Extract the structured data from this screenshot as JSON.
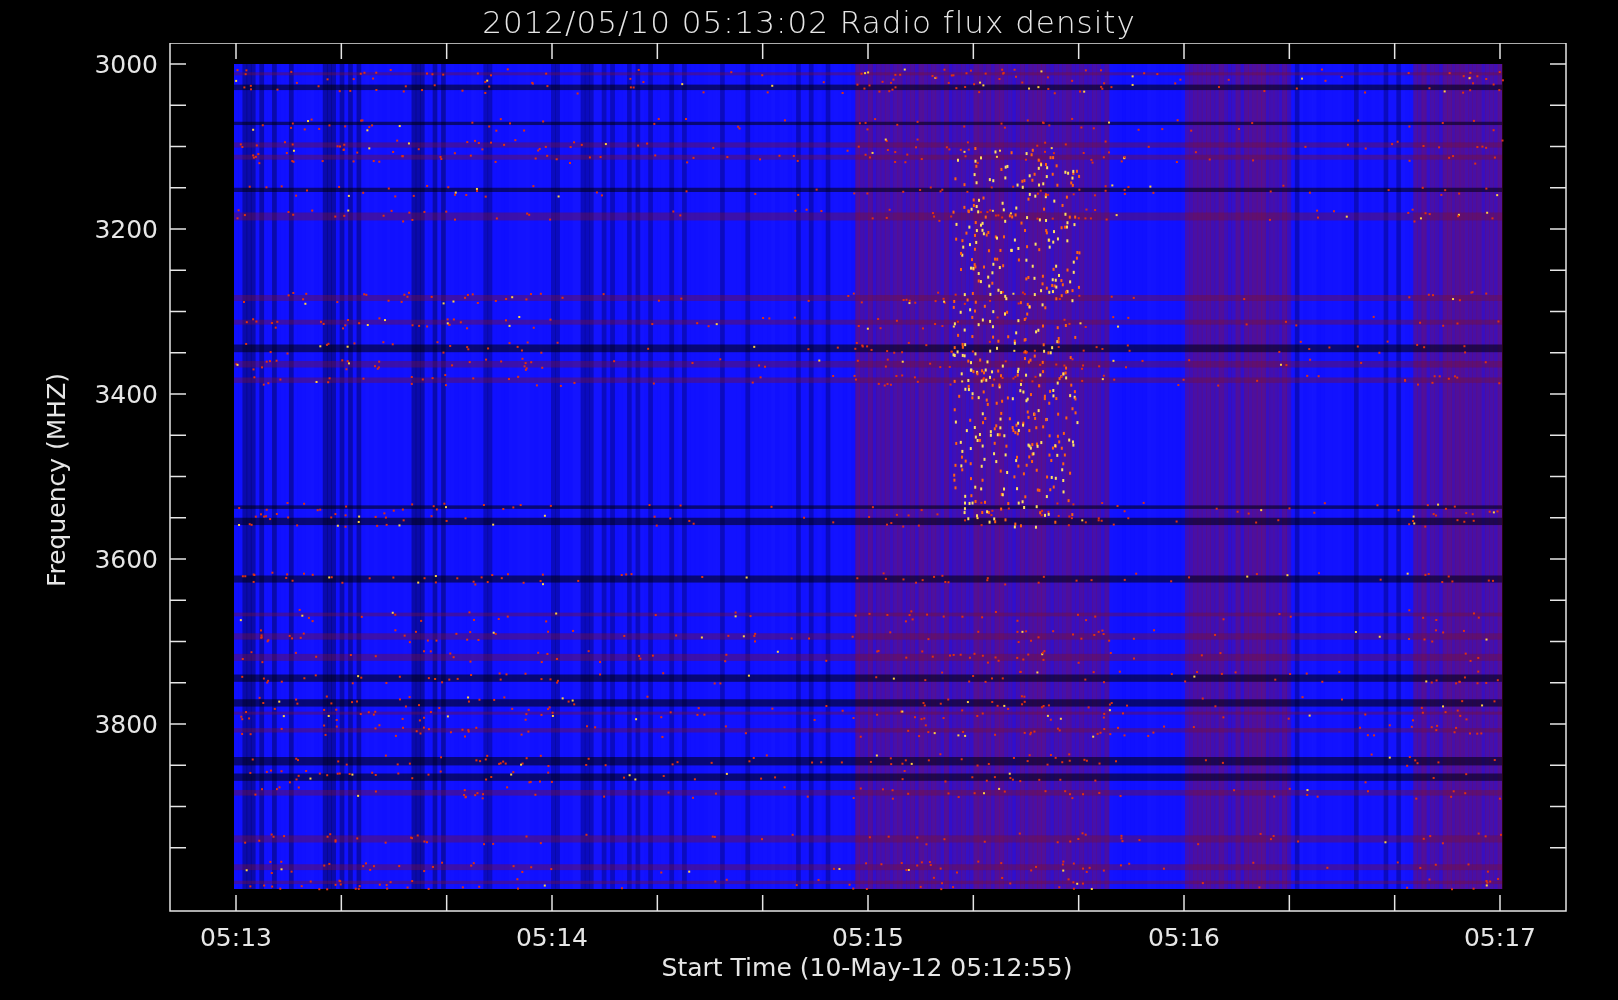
{
  "title": "2012/05/10 05:13:02 Radio flux density",
  "y_axis": {
    "label": "Frequency (MHZ)",
    "ticks": [
      "3000",
      "3200",
      "3400",
      "3600",
      "3800"
    ]
  },
  "x_axis": {
    "label": "Start Time (10-May-12 05:12:55)",
    "ticks": [
      "05:13",
      "05:14",
      "05:15",
      "05:16",
      "05:17"
    ]
  }
}
